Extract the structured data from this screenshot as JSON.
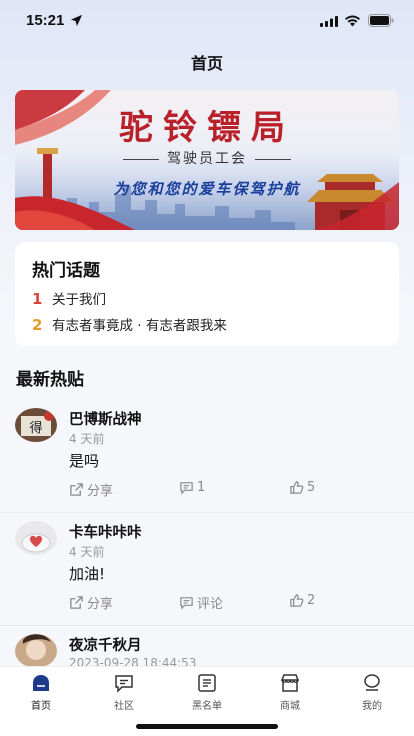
{
  "status_bar": {
    "time": "15:21"
  },
  "nav": {
    "title": "首页"
  },
  "banner": {
    "title": "驼铃镖局",
    "subtitle": "驾驶员工会",
    "slogan": "为您和您的爱车保驾护航"
  },
  "hot_topics": {
    "title": "热门话题",
    "items": [
      {
        "rank": "1",
        "text": "关于我们"
      },
      {
        "rank": "2",
        "text": "有志者事竟成 · 有志者跟我来"
      }
    ]
  },
  "latest": {
    "title": "最新热贴"
  },
  "posts": [
    {
      "name": "巴博斯战神",
      "time": "4 天前",
      "content": "是吗",
      "share": "分享",
      "comments": "1",
      "likes": "5"
    },
    {
      "name": "卡车咔咔咔",
      "time": "4 天前",
      "content": "加油!",
      "share": "分享",
      "comments": "评论",
      "likes": "2"
    },
    {
      "name": "夜凉千秋月",
      "time": "2023-09-28 18:44:53"
    }
  ],
  "tabs": [
    {
      "label": "首页",
      "icon": "home-icon",
      "active": true
    },
    {
      "label": "社区",
      "icon": "community-icon"
    },
    {
      "label": "黑名单",
      "icon": "blacklist-icon"
    },
    {
      "label": "商城",
      "icon": "shop-icon"
    },
    {
      "label": "我的",
      "icon": "profile-icon"
    }
  ],
  "colors": {
    "accent": "#1e3a8a",
    "rank1": "#d9453a",
    "rank2": "#e69a2b",
    "banner_title": "#b8212a"
  }
}
